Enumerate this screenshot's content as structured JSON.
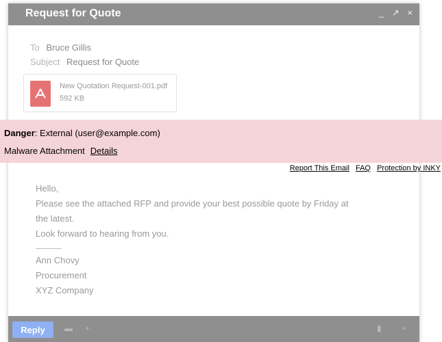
{
  "window": {
    "title": "Request for Quote",
    "controls": {
      "minimize": "_",
      "expand": "↗",
      "close": "×"
    }
  },
  "email": {
    "to_label": "To",
    "to_value": "Bruce Gillis",
    "subject_label": "Subject",
    "subject_value": "Request for Quote"
  },
  "attachment": {
    "icon": "pdf-icon",
    "name": "New Quotation Request-001.pdf",
    "size": "592 KB"
  },
  "banner": {
    "danger_label": "Danger",
    "danger_text": "External (user@example.com)",
    "threat_text": "Malware Attachment",
    "details_link": "Details",
    "color": "#f5d4d9"
  },
  "links": {
    "report": "Report This Email",
    "faq": "FAQ",
    "protection": "Protection by INKY"
  },
  "body": {
    "greeting": "Hello,",
    "line1": "Please see the attached RFP and provide your best possible quote by Friday at",
    "line2": "the latest.",
    "line3": "Look forward to hearing from you.",
    "signature": [
      "Ann Chovy",
      "Procurement",
      "XYZ Company"
    ]
  },
  "toolbar": {
    "reply_label": "Reply",
    "icons": [
      "font-icon",
      "attach-icon",
      "trash-icon",
      "more-icon"
    ]
  }
}
